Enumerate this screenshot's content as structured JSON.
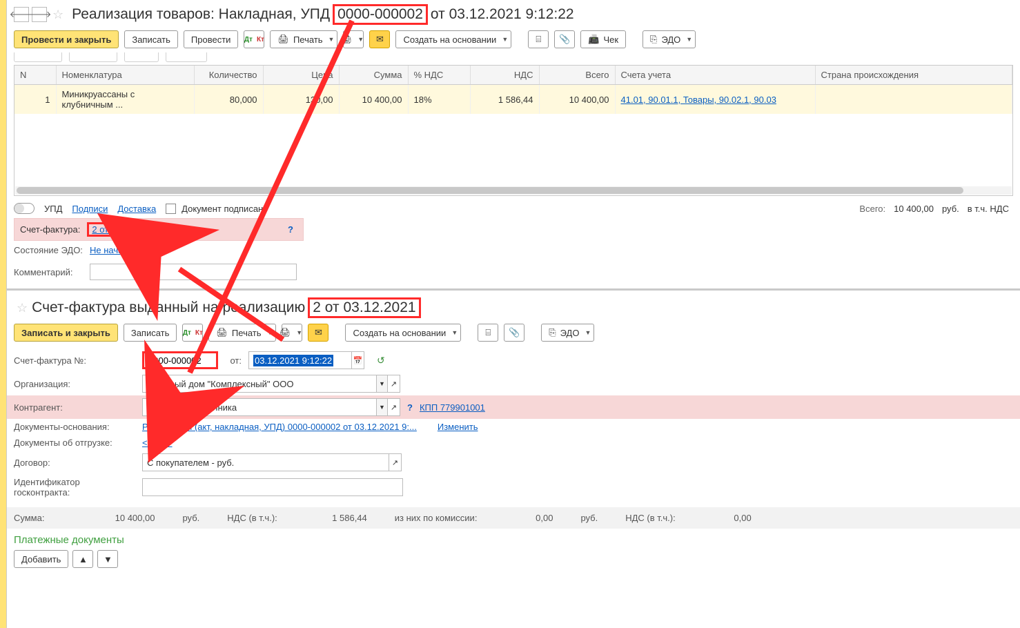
{
  "top": {
    "title_prefix": "Реализация товаров: Накладная, УПД",
    "title_num": "0000-000002",
    "title_suffix": "от 03.12.2021 9:12:22",
    "buttons": {
      "post_close": "Провести и закрыть",
      "save": "Записать",
      "post": "Провести",
      "print": "Печать",
      "create_based": "Создать на основании",
      "cheque": "Чек",
      "edo": "ЭДО"
    },
    "table": {
      "headers": {
        "n": "N",
        "item": "Номенклатура",
        "qty": "Количество",
        "price": "Цена",
        "sum": "Сумма",
        "vat_rate": "% НДС",
        "vat": "НДС",
        "total": "Всего",
        "accts": "Счета учета",
        "country": "Страна происхождения"
      },
      "rows": [
        {
          "n": "1",
          "item": "Миникруассаны с клубничным ...",
          "qty": "80,000",
          "price": "130,00",
          "sum": "10 400,00",
          "vat_rate": "18%",
          "vat": "1 586,44",
          "total": "10 400,00",
          "accts": "41.01, 90.01.1, Товары, 90.02.1, 90.03",
          "country": ""
        }
      ]
    },
    "below": {
      "upd": "УПД",
      "signatures": "Подписи",
      "delivery": "Доставка",
      "doc_signed": "Документ подписан",
      "totals_label": "Всего:",
      "totals_value": "10 400,00",
      "totals_cur": "руб.",
      "totals_incl": "в т.ч. НДС"
    },
    "sf": {
      "label": "Счет-фактура:",
      "link": "2 от 03.12.2021"
    },
    "edo_state": {
      "label": "Состояние ЭДО:",
      "link": "Не начат"
    },
    "comment_label": "Комментарий:"
  },
  "bottom": {
    "title_prefix": "Счет-фактура выданный на реализацию",
    "title_num": "2 от 03.12.2021",
    "buttons": {
      "save_close": "Записать и закрыть",
      "save": "Записать",
      "print": "Печать",
      "create_based": "Создать на основании",
      "edo": "ЭДО"
    },
    "fields": {
      "sf_no_label": "Счет-фактура №:",
      "sf_no_value": "0000-000002",
      "date_label": "от:",
      "date_value": "03.12.2021  9:12:22",
      "org_label": "Организация:",
      "org_value": "Торговый дом \"Комплексный\" ООО",
      "ca_label": "Контрагент:",
      "ca_value": "Антикафе Земляника",
      "kpp": "КПП 779901001",
      "doc_basis_label": "Документы-основания:",
      "doc_basis_link": "Реализация (акт, накладная, УПД) 0000-000002 от 03.12.2021 9:...",
      "change": "Изменить",
      "ship_docs_label": "Документы об отгрузке:",
      "ship_docs_link": "<Авто>",
      "contract_label": "Договор:",
      "contract_value": "С покупателем - руб.",
      "gos_id_label": "Идентификатор госконтракта:"
    },
    "sumbar": {
      "sum_label": "Сумма:",
      "sum_value": "10 400,00",
      "rub": "руб.",
      "vat_in_label": "НДС (в т.ч.):",
      "vat_in_value": "1 586,44",
      "comm_label": "из них по комиссии:",
      "comm_value": "0,00",
      "rub2": "руб.",
      "vat_comm_label": "НДС (в т.ч.):",
      "vat_comm_value": "0,00"
    },
    "paydocs": "Платежные документы",
    "addbtn": "Добавить"
  }
}
